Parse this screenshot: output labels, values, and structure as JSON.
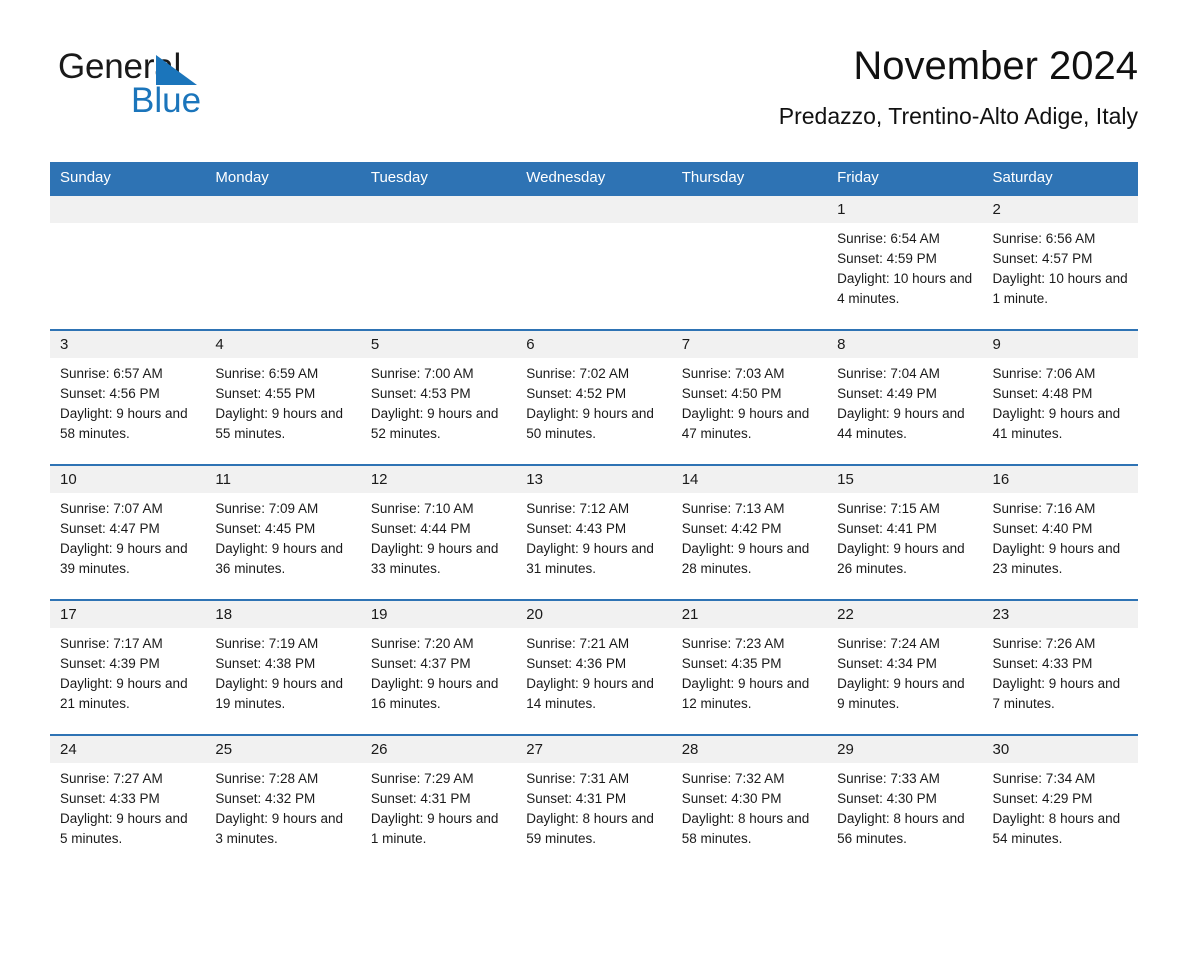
{
  "logo": {
    "word_one": "General",
    "word_two": "Blue",
    "triangle_icon": "triangle-icon",
    "brand_color": "#1b75bb"
  },
  "header": {
    "title": "November 2024",
    "subtitle": "Predazzo, Trentino-Alto Adige, Italy",
    "accent_color": "#2e73b4",
    "daynum_band_color": "#f1f1f1"
  },
  "calendar": {
    "weekdays": [
      "Sunday",
      "Monday",
      "Tuesday",
      "Wednesday",
      "Thursday",
      "Friday",
      "Saturday"
    ],
    "labels": {
      "sunrise": "Sunrise:",
      "sunset": "Sunset:",
      "daylight": "Daylight:"
    },
    "weeks": [
      [
        {
          "day": "",
          "empty": true
        },
        {
          "day": "",
          "empty": true
        },
        {
          "day": "",
          "empty": true
        },
        {
          "day": "",
          "empty": true
        },
        {
          "day": "",
          "empty": true
        },
        {
          "day": "1",
          "sunrise": "Sunrise: 6:54 AM",
          "sunset": "Sunset: 4:59 PM",
          "daylight": "Daylight: 10 hours and 4 minutes."
        },
        {
          "day": "2",
          "sunrise": "Sunrise: 6:56 AM",
          "sunset": "Sunset: 4:57 PM",
          "daylight": "Daylight: 10 hours and 1 minute."
        }
      ],
      [
        {
          "day": "3",
          "sunrise": "Sunrise: 6:57 AM",
          "sunset": "Sunset: 4:56 PM",
          "daylight": "Daylight: 9 hours and 58 minutes."
        },
        {
          "day": "4",
          "sunrise": "Sunrise: 6:59 AM",
          "sunset": "Sunset: 4:55 PM",
          "daylight": "Daylight: 9 hours and 55 minutes."
        },
        {
          "day": "5",
          "sunrise": "Sunrise: 7:00 AM",
          "sunset": "Sunset: 4:53 PM",
          "daylight": "Daylight: 9 hours and 52 minutes."
        },
        {
          "day": "6",
          "sunrise": "Sunrise: 7:02 AM",
          "sunset": "Sunset: 4:52 PM",
          "daylight": "Daylight: 9 hours and 50 minutes."
        },
        {
          "day": "7",
          "sunrise": "Sunrise: 7:03 AM",
          "sunset": "Sunset: 4:50 PM",
          "daylight": "Daylight: 9 hours and 47 minutes."
        },
        {
          "day": "8",
          "sunrise": "Sunrise: 7:04 AM",
          "sunset": "Sunset: 4:49 PM",
          "daylight": "Daylight: 9 hours and 44 minutes."
        },
        {
          "day": "9",
          "sunrise": "Sunrise: 7:06 AM",
          "sunset": "Sunset: 4:48 PM",
          "daylight": "Daylight: 9 hours and 41 minutes."
        }
      ],
      [
        {
          "day": "10",
          "sunrise": "Sunrise: 7:07 AM",
          "sunset": "Sunset: 4:47 PM",
          "daylight": "Daylight: 9 hours and 39 minutes."
        },
        {
          "day": "11",
          "sunrise": "Sunrise: 7:09 AM",
          "sunset": "Sunset: 4:45 PM",
          "daylight": "Daylight: 9 hours and 36 minutes."
        },
        {
          "day": "12",
          "sunrise": "Sunrise: 7:10 AM",
          "sunset": "Sunset: 4:44 PM",
          "daylight": "Daylight: 9 hours and 33 minutes."
        },
        {
          "day": "13",
          "sunrise": "Sunrise: 7:12 AM",
          "sunset": "Sunset: 4:43 PM",
          "daylight": "Daylight: 9 hours and 31 minutes."
        },
        {
          "day": "14",
          "sunrise": "Sunrise: 7:13 AM",
          "sunset": "Sunset: 4:42 PM",
          "daylight": "Daylight: 9 hours and 28 minutes."
        },
        {
          "day": "15",
          "sunrise": "Sunrise: 7:15 AM",
          "sunset": "Sunset: 4:41 PM",
          "daylight": "Daylight: 9 hours and 26 minutes."
        },
        {
          "day": "16",
          "sunrise": "Sunrise: 7:16 AM",
          "sunset": "Sunset: 4:40 PM",
          "daylight": "Daylight: 9 hours and 23 minutes."
        }
      ],
      [
        {
          "day": "17",
          "sunrise": "Sunrise: 7:17 AM",
          "sunset": "Sunset: 4:39 PM",
          "daylight": "Daylight: 9 hours and 21 minutes."
        },
        {
          "day": "18",
          "sunrise": "Sunrise: 7:19 AM",
          "sunset": "Sunset: 4:38 PM",
          "daylight": "Daylight: 9 hours and 19 minutes."
        },
        {
          "day": "19",
          "sunrise": "Sunrise: 7:20 AM",
          "sunset": "Sunset: 4:37 PM",
          "daylight": "Daylight: 9 hours and 16 minutes."
        },
        {
          "day": "20",
          "sunrise": "Sunrise: 7:21 AM",
          "sunset": "Sunset: 4:36 PM",
          "daylight": "Daylight: 9 hours and 14 minutes."
        },
        {
          "day": "21",
          "sunrise": "Sunrise: 7:23 AM",
          "sunset": "Sunset: 4:35 PM",
          "daylight": "Daylight: 9 hours and 12 minutes."
        },
        {
          "day": "22",
          "sunrise": "Sunrise: 7:24 AM",
          "sunset": "Sunset: 4:34 PM",
          "daylight": "Daylight: 9 hours and 9 minutes."
        },
        {
          "day": "23",
          "sunrise": "Sunrise: 7:26 AM",
          "sunset": "Sunset: 4:33 PM",
          "daylight": "Daylight: 9 hours and 7 minutes."
        }
      ],
      [
        {
          "day": "24",
          "sunrise": "Sunrise: 7:27 AM",
          "sunset": "Sunset: 4:33 PM",
          "daylight": "Daylight: 9 hours and 5 minutes."
        },
        {
          "day": "25",
          "sunrise": "Sunrise: 7:28 AM",
          "sunset": "Sunset: 4:32 PM",
          "daylight": "Daylight: 9 hours and 3 minutes."
        },
        {
          "day": "26",
          "sunrise": "Sunrise: 7:29 AM",
          "sunset": "Sunset: 4:31 PM",
          "daylight": "Daylight: 9 hours and 1 minute."
        },
        {
          "day": "27",
          "sunrise": "Sunrise: 7:31 AM",
          "sunset": "Sunset: 4:31 PM",
          "daylight": "Daylight: 8 hours and 59 minutes."
        },
        {
          "day": "28",
          "sunrise": "Sunrise: 7:32 AM",
          "sunset": "Sunset: 4:30 PM",
          "daylight": "Daylight: 8 hours and 58 minutes."
        },
        {
          "day": "29",
          "sunrise": "Sunrise: 7:33 AM",
          "sunset": "Sunset: 4:30 PM",
          "daylight": "Daylight: 8 hours and 56 minutes."
        },
        {
          "day": "30",
          "sunrise": "Sunrise: 7:34 AM",
          "sunset": "Sunset: 4:29 PM",
          "daylight": "Daylight: 8 hours and 54 minutes."
        }
      ]
    ]
  }
}
